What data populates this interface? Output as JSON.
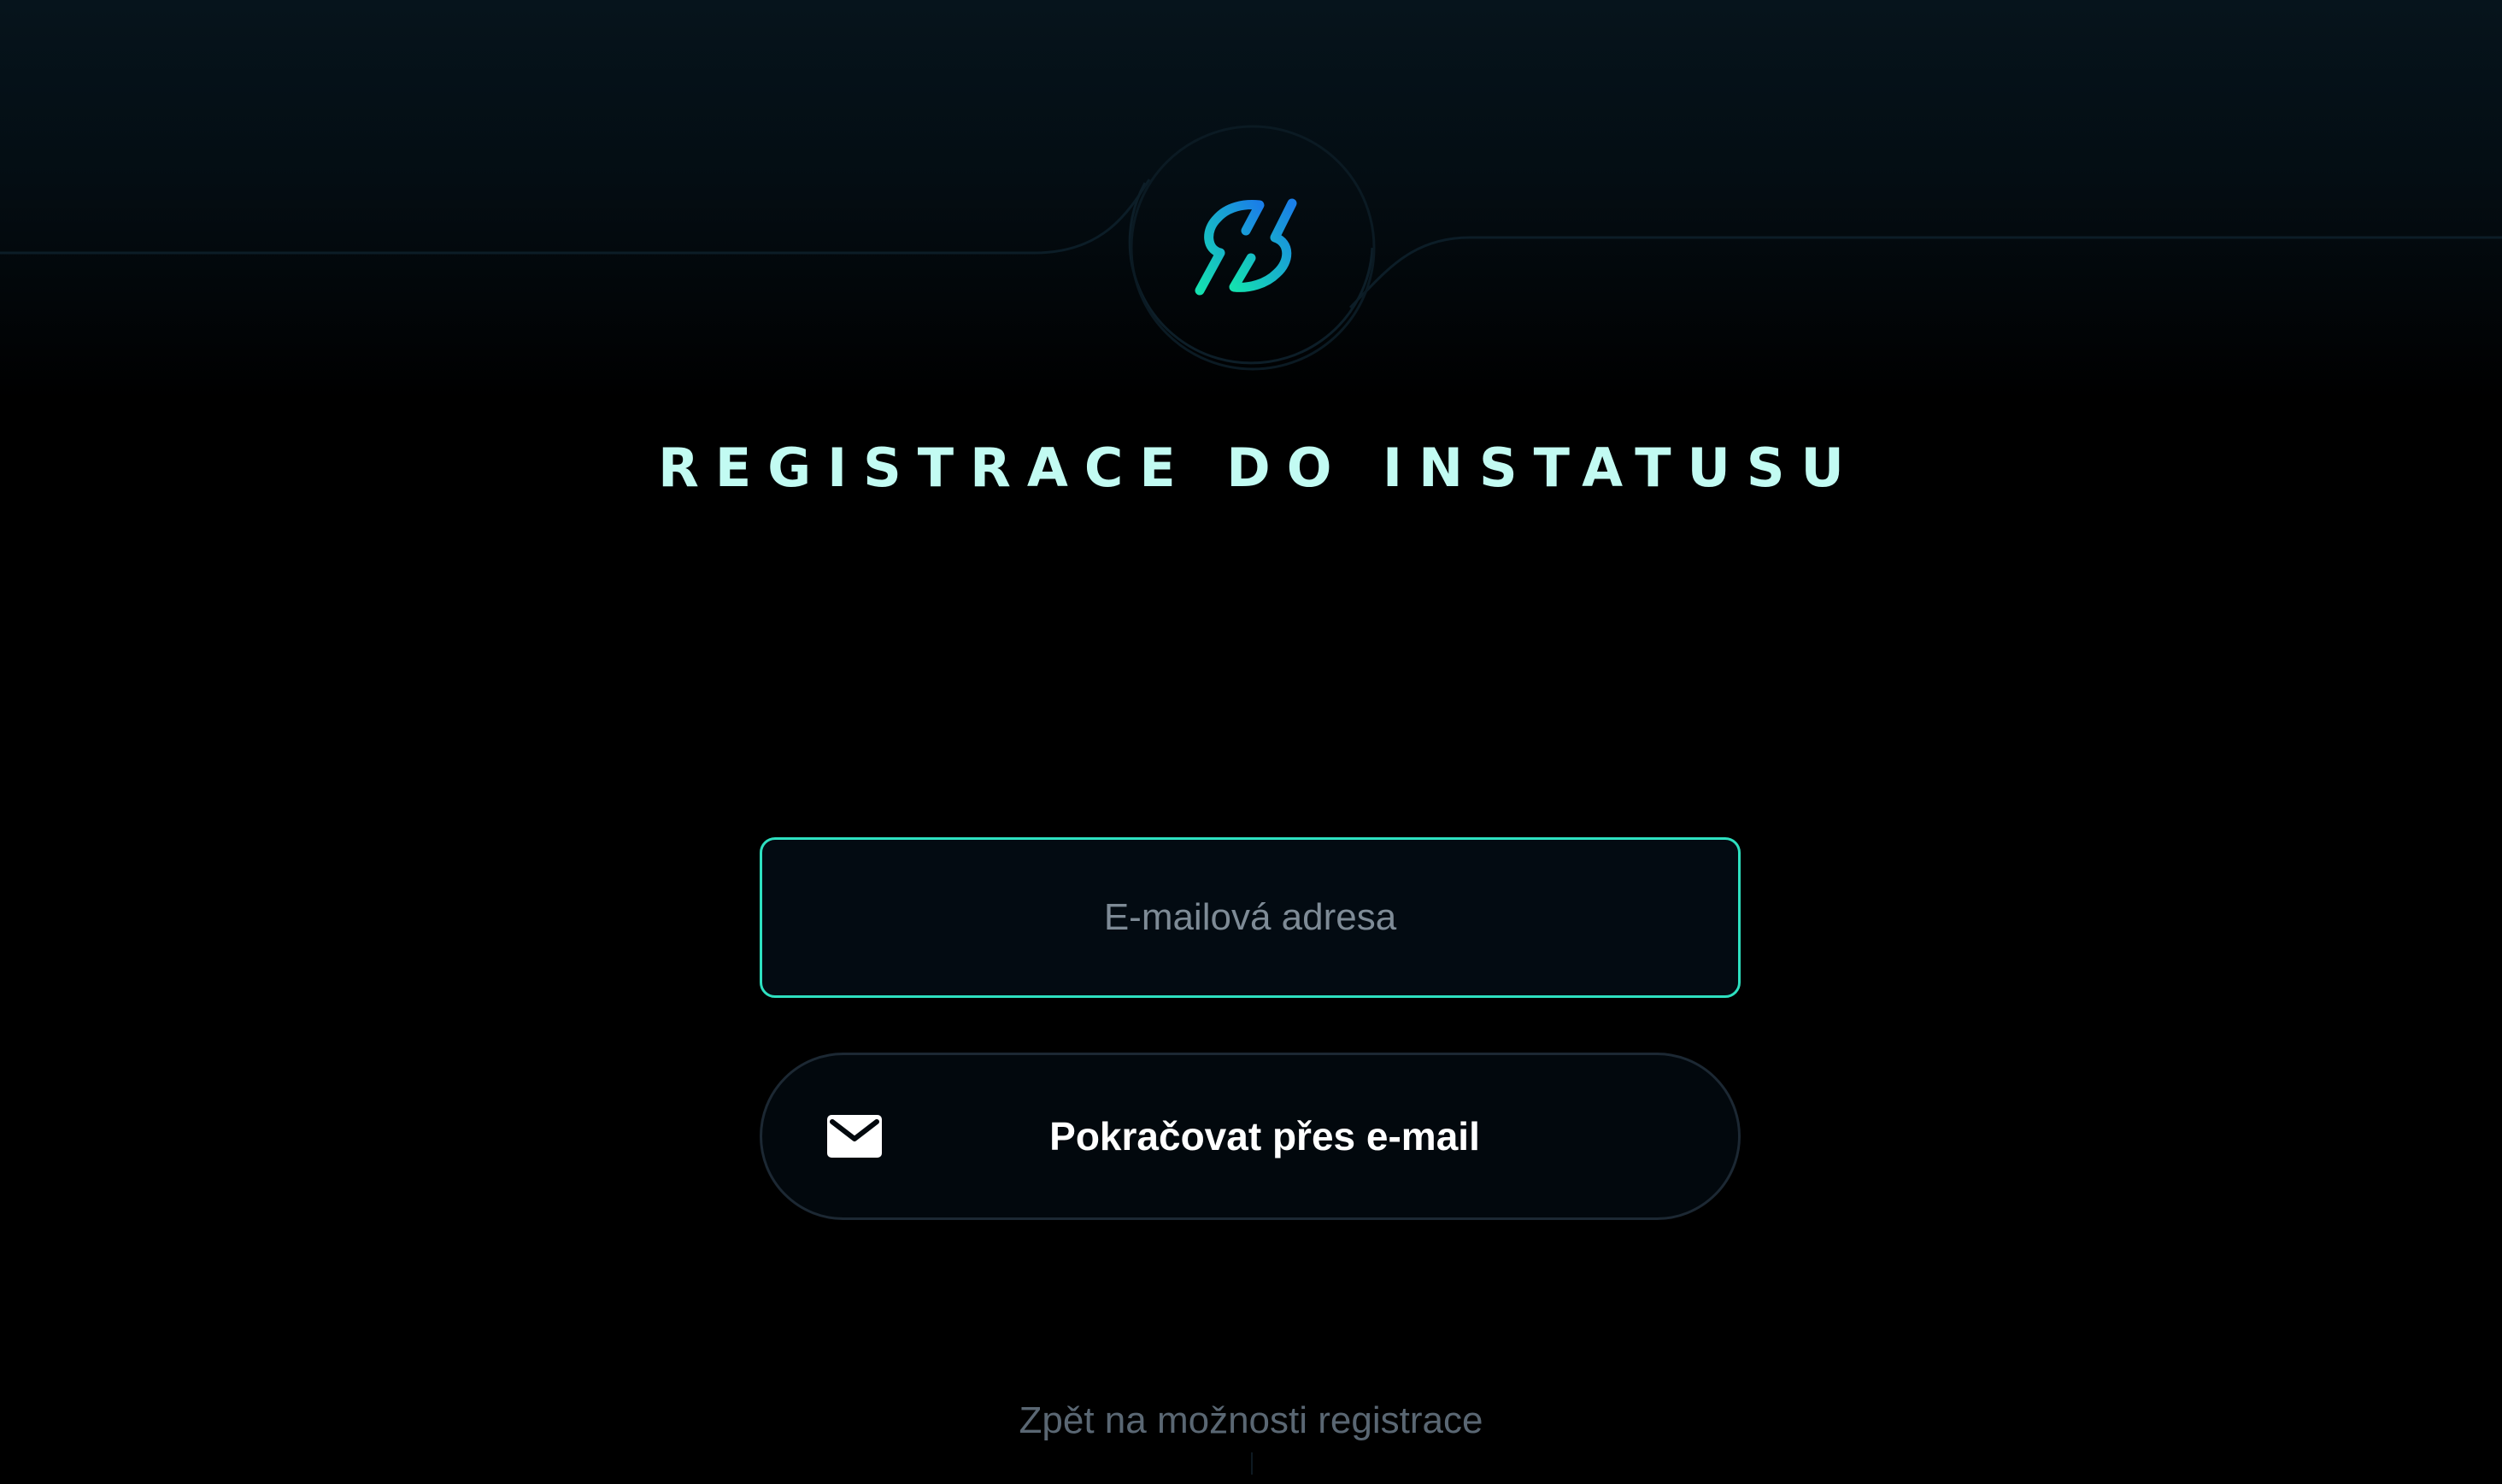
{
  "header": {
    "logo_icon": "instatus-bolt-logo",
    "title": "REGISTRACE DO INSTATUSU"
  },
  "form": {
    "email_placeholder": "E-mailová adresa",
    "email_value": "",
    "continue_icon": "mail-icon",
    "continue_label": "Pokračovat přes e-mail"
  },
  "footer": {
    "back_link": "Zpět na možnosti registrace"
  },
  "colors": {
    "accent": "#2ee0c0",
    "title": "#c2fbf2",
    "logo_gradient_start": "#14e0b0",
    "logo_gradient_end": "#1a7fe8",
    "background": "#000000"
  }
}
